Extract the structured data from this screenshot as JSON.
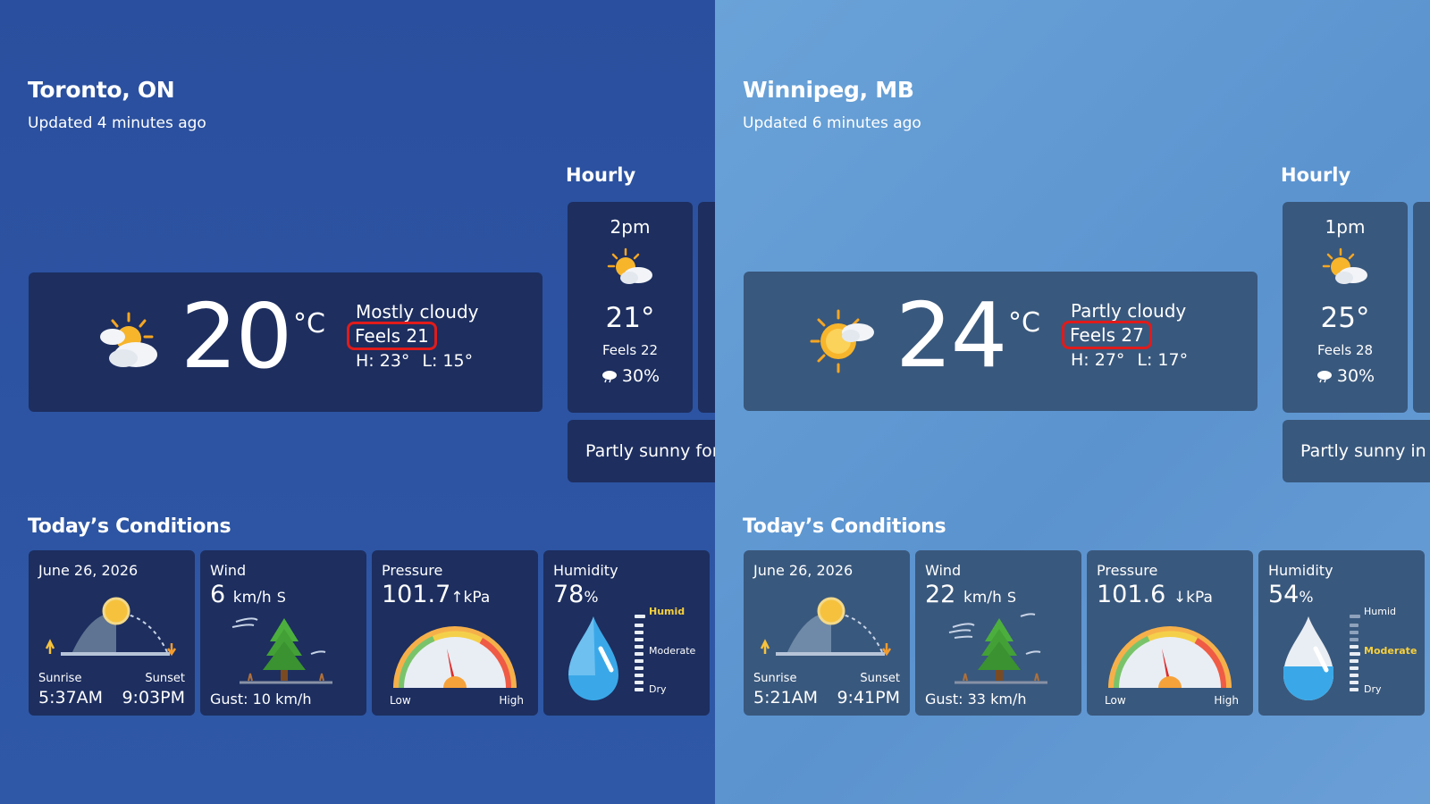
{
  "panels": [
    {
      "city": "Toronto, ON",
      "updated": "Updated 4 minutes ago",
      "current": {
        "temp": "20",
        "unit": "°C",
        "condition": "Mostly cloudy",
        "feels": "Feels 21",
        "high": "H: 23°",
        "low": "L: 15°",
        "icon": "mostly-cloudy-icon"
      },
      "hourly": {
        "title": "Hourly",
        "time": "2pm",
        "temp": "21°",
        "feels": "Feels 22",
        "pop": "30%",
        "icon": "partly-sunny-icon",
        "summary": "Partly sunny for"
      },
      "today": {
        "title": "Today’s Conditions",
        "date": "June 26, 2026",
        "sunrise_label": "Sunrise",
        "sunset_label": "Sunset",
        "sunrise": "5:37AM",
        "sunset": "9:03PM",
        "wind_label": "Wind",
        "wind_speed": "6",
        "wind_unit": "km/h",
        "wind_dir": "S",
        "gust": "Gust: 10 km/h",
        "pressure_label": "Pressure",
        "pressure": "101.7",
        "pressure_trend": "↑",
        "pressure_unit": "kPa",
        "pressure_low": "Low",
        "pressure_high": "High",
        "humidity_label": "Humidity",
        "humidity": "78",
        "humidity_unit": "%",
        "humidity_levels": [
          "Humid",
          "Moderate",
          "Dry"
        ],
        "humidity_active": "Humid"
      }
    },
    {
      "city": "Winnipeg, MB",
      "updated": "Updated 6 minutes ago",
      "current": {
        "temp": "24",
        "unit": "°C",
        "condition": "Partly cloudy",
        "feels": "Feels 27",
        "high": "H: 27°",
        "low": "L: 17°",
        "icon": "partly-cloudy-icon"
      },
      "hourly": {
        "title": "Hourly",
        "time": "1pm",
        "temp": "25°",
        "feels": "Feels 28",
        "pop": "30%",
        "icon": "partly-sunny-icon",
        "summary": "Partly sunny in"
      },
      "today": {
        "title": "Today’s Conditions",
        "date": "June 26, 2026",
        "sunrise_label": "Sunrise",
        "sunset_label": "Sunset",
        "sunrise": "5:21AM",
        "sunset": "9:41PM",
        "wind_label": "Wind",
        "wind_speed": "22",
        "wind_unit": "km/h",
        "wind_dir": "S",
        "gust": "Gust: 33 km/h",
        "pressure_label": "Pressure",
        "pressure": "101.6",
        "pressure_trend": "↓",
        "pressure_unit": "kPa",
        "pressure_low": "Low",
        "pressure_high": "High",
        "humidity_label": "Humidity",
        "humidity": "54",
        "humidity_unit": "%",
        "humidity_levels": [
          "Humid",
          "Moderate",
          "Dry"
        ],
        "humidity_active": "Moderate"
      }
    }
  ],
  "colors": {
    "highlight_ring": "#e01b1b",
    "humidity_active": "#f7d03c",
    "left_bg": "#2b519f",
    "right_bg": "#6aa3d8"
  }
}
